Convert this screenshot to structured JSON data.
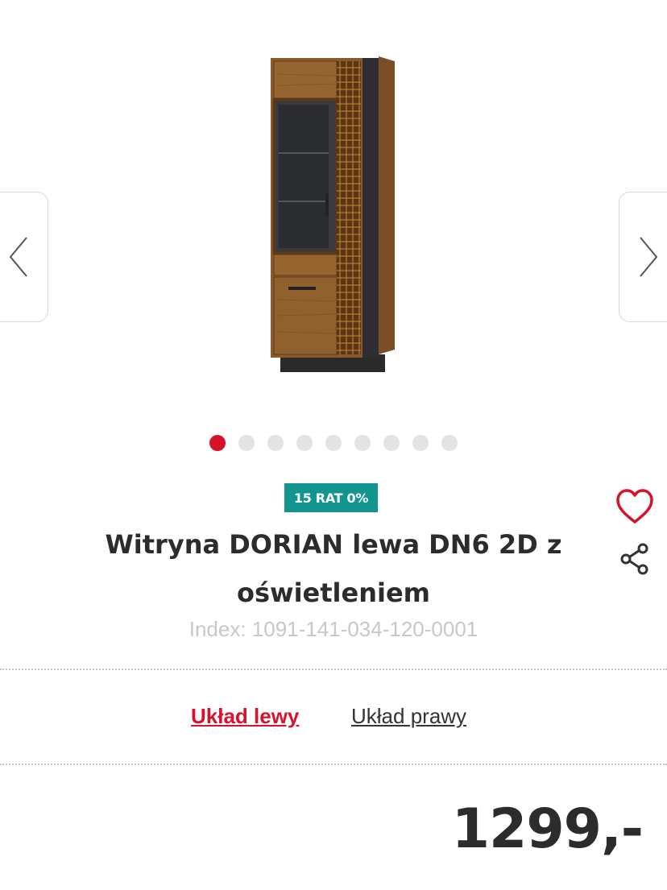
{
  "gallery": {
    "image_alt_icon": "display-cabinet-image",
    "slide_count": 9,
    "active_slide": 1,
    "prev_icon": "chevron-left-icon",
    "next_icon": "chevron-right-icon"
  },
  "product": {
    "badge": "15 RAT 0%",
    "title": "Witryna DORIAN lewa DN6 2D z oświetleniem",
    "index": "Index: 1091-141-034-120-0001",
    "price": "1299,-"
  },
  "actions": {
    "favorite_icon": "heart-icon",
    "share_icon": "share-icon"
  },
  "variants": {
    "left_label": "Układ lewy",
    "right_label": "Układ prawy"
  },
  "colors": {
    "accent": "#d6132a",
    "badge": "#11958e",
    "text": "#2c2c2c",
    "muted": "#c8c8c8"
  }
}
